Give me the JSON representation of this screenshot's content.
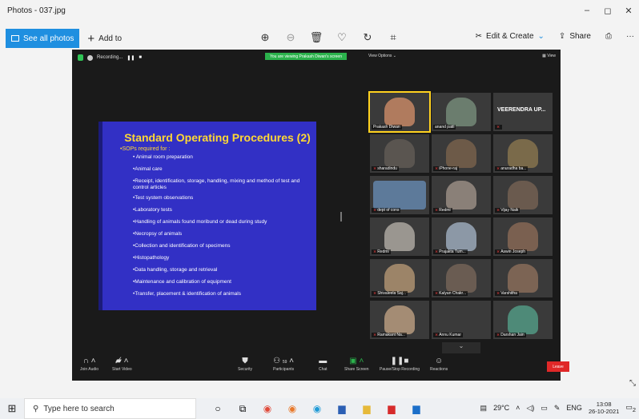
{
  "window": {
    "title": "Photos - 037.jpg",
    "controls": [
      "–",
      "◻",
      "✕"
    ]
  },
  "toolbar": {
    "see_all": "See all photos",
    "add_to": "Add to",
    "edit_create": "Edit & Create",
    "share": "Share",
    "icons": [
      "zoom-in-icon",
      "zoom-out-icon",
      "delete-icon",
      "favorite-icon",
      "rotate-icon",
      "crop-icon"
    ]
  },
  "zoom": {
    "recording": "Recording...",
    "viewing_banner": "You are viewing Prakash Diwan's screen",
    "view_options": "View Options ⌄",
    "view": "View",
    "slide": {
      "title": "Standard Operating Procedures (2)",
      "subtitle": "•SOPs required for :",
      "items": [
        "• Animal room preparation",
        "•Animal care",
        "•Receipt, identification, storage, handling, mixing and method of test and control articles",
        "•Test system observations",
        "•Laboratory tests",
        "•Handling of animals found moribund or dead during study",
        "•Necropsy of animals",
        "•Collection and identification of specimens",
        "•Histopathology",
        "•Data handling, storage and retrieval",
        "•Maintenance and calibration of equipment",
        "•Transfer, placement & identification of animals"
      ]
    },
    "participants": [
      {
        "name": "Prakash Diwan",
        "active": true
      },
      {
        "name": "anand patil",
        "muted": false
      },
      {
        "name": "VEERENDRA UP...",
        "video": false
      },
      {
        "name": "sharadindu",
        "muted": true
      },
      {
        "name": "iPhone-raj",
        "muted": true
      },
      {
        "name": "anuradha ba...",
        "muted": true
      },
      {
        "name": "dept of cons",
        "muted": true
      },
      {
        "name": "Redmi",
        "muted": true
      },
      {
        "name": "Vijay Naik",
        "muted": true
      },
      {
        "name": "Redmi",
        "muted": true
      },
      {
        "name": "Prajakta Tum...",
        "muted": true
      },
      {
        "name": "Aswin Joseph",
        "muted": true
      },
      {
        "name": "Shivaleela Saj...",
        "muted": true
      },
      {
        "name": "Kalyan Chakr...",
        "muted": true
      },
      {
        "name": "Varshitha",
        "muted": true
      },
      {
        "name": "Ramakant Na...",
        "muted": true
      },
      {
        "name": "Annu Kumar",
        "muted": true
      },
      {
        "name": "Darshan Jain",
        "muted": true
      }
    ],
    "controls": {
      "join_audio": "Join Audio",
      "start_video": "Start Video",
      "security": "Security",
      "participants": "Participants",
      "participants_count": "59",
      "chat": "Chat",
      "share_screen": "Share Screen",
      "recording": "Pause/Stop Recording",
      "reactions": "Reactions",
      "leave": "Leave"
    }
  },
  "taskbar": {
    "search_placeholder": "Type here to search",
    "weather": "29°C",
    "lang": "ENG",
    "time": "13:08",
    "date": "26-10-2021",
    "notifications": "2"
  },
  "colors": {
    "zoom_bg": "#1a1a1a",
    "slide_bg": "#3230c5",
    "slide_title": "#ffd834",
    "accent": "#1f8fe0",
    "share_green": "#2bb24c",
    "leave_red": "#e02828"
  }
}
